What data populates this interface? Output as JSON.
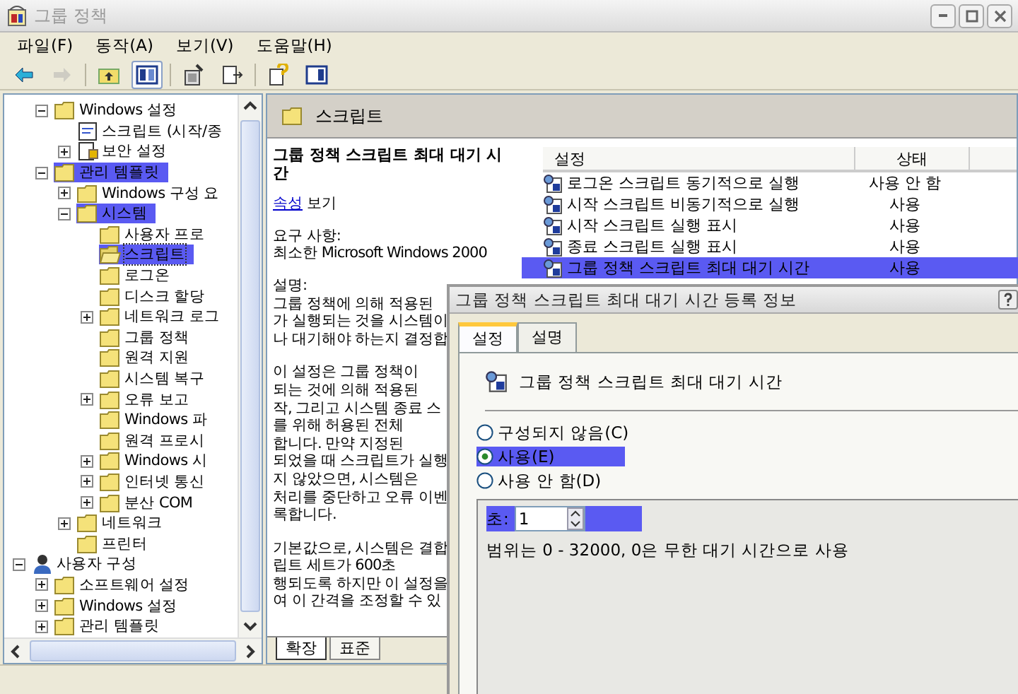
{
  "window": {
    "title": "그룹 정책"
  },
  "menu": [
    "파일(F)",
    "동작(A)",
    "보기(V)",
    "도움말(H)"
  ],
  "toolbar": [
    {
      "kind": "back",
      "disabled": false,
      "pressed": false
    },
    {
      "kind": "forward",
      "disabled": true,
      "pressed": false
    },
    {
      "kind": "separator"
    },
    {
      "kind": "up",
      "disabled": false,
      "pressed": false
    },
    {
      "kind": "tree",
      "disabled": false,
      "pressed": true
    },
    {
      "kind": "separator"
    },
    {
      "kind": "properties",
      "disabled": false,
      "pressed": false
    },
    {
      "kind": "export",
      "disabled": false,
      "pressed": false
    },
    {
      "kind": "separator"
    },
    {
      "kind": "help",
      "disabled": false,
      "pressed": false
    },
    {
      "kind": "pane",
      "disabled": false,
      "pressed": false
    }
  ],
  "tree": {
    "items": [
      {
        "children": [
          {
            "label": "Windows 설정",
            "kind": "folder",
            "expanded": true,
            "selected": false,
            "highlighted": false,
            "children": [
              {
                "label": "스크립트 (시작/종",
                "kind": "script",
                "selected": false,
                "highlighted": false
              },
              {
                "label": "보안 설정",
                "kind": "security",
                "expanded": false,
                "selected": false,
                "highlighted": false
              }
            ]
          },
          {
            "label": "관리 템플릿",
            "kind": "folder",
            "expanded": true,
            "selected": false,
            "highlighted": true,
            "children": [
              {
                "label": "Windows 구성 요",
                "kind": "folder",
                "expanded": false,
                "selected": false,
                "highlighted": false
              },
              {
                "label": "시스템",
                "kind": "folder",
                "expanded": true,
                "selected": false,
                "highlighted": true,
                "children": [
                  {
                    "label": "사용자 프로",
                    "kind": "folder",
                    "selected": false,
                    "highlighted": false
                  },
                  {
                    "label": "스크립트",
                    "kind": "folder-open",
                    "selected": true,
                    "highlighted": true
                  },
                  {
                    "label": "로그온",
                    "kind": "folder",
                    "selected": false,
                    "highlighted": false
                  },
                  {
                    "label": "디스크 할당",
                    "kind": "folder",
                    "selected": false,
                    "highlighted": false
                  },
                  {
                    "label": "네트워크 로그",
                    "kind": "folder",
                    "expanded": false,
                    "selected": false,
                    "highlighted": false
                  },
                  {
                    "label": "그룹 정책",
                    "kind": "folder",
                    "selected": false,
                    "highlighted": false
                  },
                  {
                    "label": "원격 지원",
                    "kind": "folder",
                    "selected": false,
                    "highlighted": false
                  },
                  {
                    "label": "시스템 복구",
                    "kind": "folder",
                    "selected": false,
                    "highlighted": false
                  },
                  {
                    "label": "오류 보고",
                    "kind": "folder",
                    "expanded": false,
                    "selected": false,
                    "highlighted": false
                  },
                  {
                    "label": "Windows 파",
                    "kind": "folder",
                    "selected": false,
                    "highlighted": false
                  },
                  {
                    "label": "원격 프로시",
                    "kind": "folder",
                    "selected": false,
                    "highlighted": false
                  },
                  {
                    "label": "Windows 시",
                    "kind": "folder",
                    "expanded": false,
                    "selected": false,
                    "highlighted": false
                  },
                  {
                    "label": "인터넷 통신",
                    "kind": "folder",
                    "expanded": false,
                    "selected": false,
                    "highlighted": false
                  },
                  {
                    "label": "분산 COM",
                    "kind": "folder",
                    "expanded": false,
                    "selected": false,
                    "highlighted": false
                  }
                ]
              },
              {
                "label": "네트워크",
                "kind": "folder",
                "expanded": false,
                "selected": false,
                "highlighted": false
              },
              {
                "label": "프린터",
                "kind": "folder",
                "selected": false,
                "highlighted": false
              }
            ]
          }
        ]
      },
      {
        "label": "사용자 구성",
        "kind": "user",
        "expanded": true,
        "selected": false,
        "highlighted": false,
        "children": [
          {
            "label": "소프트웨어 설정",
            "kind": "folder",
            "expanded": false,
            "selected": false,
            "highlighted": false
          },
          {
            "label": "Windows 설정",
            "kind": "folder",
            "expanded": false,
            "selected": false,
            "highlighted": false
          },
          {
            "label": "관리 템플릿",
            "kind": "folder",
            "expanded": false,
            "selected": false,
            "highlighted": false
          }
        ]
      }
    ]
  },
  "header": {
    "title": "스크립트"
  },
  "description": {
    "title": "그룹 정책 스크립트 최대 대기 시간",
    "link": "속성",
    "link_suffix": "보기",
    "requirements_label": "요구 사항:",
    "requirements": "최소한 Microsoft Windows 2000",
    "explain_label": "설명:",
    "paragraphs": [
      [
        "그룹 정책에 의해 적용된",
        "가 실행되는 것을 시스템이",
        "나 대기해야 하는지 결정합"
      ],
      [
        "이 설정은 그룹 정책이",
        "되는 것에 의해 적용된",
        "작, 그리고 시스템 종료 스",
        "를 위해 허용된 전체",
        "합니다. 만약 지정된",
        "되었을 때 스크립트가 실행",
        "지 않았으면, 시스템은",
        "처리를 중단하고 오류 이벤",
        "록합니다."
      ],
      [
        "기본값으로, 시스템은 결합",
        "립트 세트가 600초",
        "행되도록 하지만 이 설정을",
        "여 이 간격을 조정할 수 있"
      ]
    ]
  },
  "list": {
    "columns": [
      "설정",
      "상태"
    ],
    "rows": [
      {
        "name": "로그온 스크립트 동기적으로 실행",
        "status": "사용 안 함",
        "highlighted": false
      },
      {
        "name": "시작 스크립트 비동기적으로 실행",
        "status": "사용",
        "highlighted": false
      },
      {
        "name": "시작 스크립트 실행 표시",
        "status": "사용",
        "highlighted": false
      },
      {
        "name": "종료 스크립트 실행 표시",
        "status": "사용",
        "highlighted": false
      },
      {
        "name": "그룹 정책 스크립트 최대 대기 시간",
        "status": "사용",
        "highlighted": true
      }
    ]
  },
  "view_tabs": [
    {
      "label": "확장",
      "selected": true
    },
    {
      "label": "표준",
      "selected": false
    }
  ],
  "dialog": {
    "title": "그룹 정책 스크립트 최대 대기 시간 등록 정보",
    "tabs": [
      {
        "label": "설정",
        "selected": true
      },
      {
        "label": "설명",
        "selected": false
      }
    ],
    "setting": "그룹 정책 스크립트 최대 대기 시간",
    "options": [
      {
        "label": "구성되지 않음(C)",
        "selected": false,
        "highlighted": false
      },
      {
        "label": "사용(E)",
        "selected": true,
        "highlighted": true
      },
      {
        "label": "사용 안 함(D)",
        "selected": false,
        "highlighted": false
      }
    ],
    "seconds": {
      "label": "초:",
      "value": "1",
      "highlighted": true
    },
    "range": "범위는 0 - 32000, 0은 무한 대기 시간으로 사용"
  }
}
